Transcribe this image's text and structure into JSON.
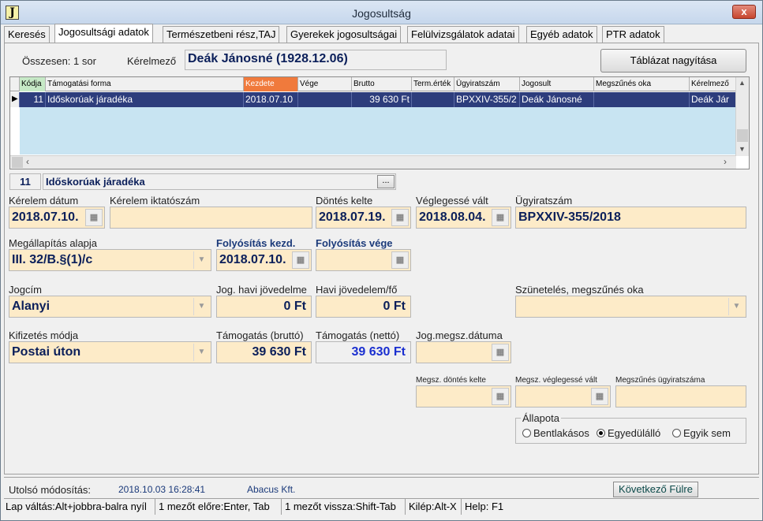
{
  "window": {
    "title": "Jogosultság",
    "app_icon_letter": "J",
    "close_label": "x"
  },
  "tabs": [
    {
      "label": "Keresés"
    },
    {
      "label": "Jogosultsági adatok"
    },
    {
      "label": "Természetbeni rész,TAJ"
    },
    {
      "label": "Gyerekek jogosultságai"
    },
    {
      "label": "Felülvizsgálatok adatai"
    },
    {
      "label": "Egyéb adatok"
    },
    {
      "label": "PTR adatok"
    }
  ],
  "summary": {
    "total_label": "Összesen: 1 sor",
    "applicant_label": "Kérelmező",
    "applicant_value": "Deák Jánosné (1928.12.06)",
    "enlarge_button": "Táblázat nagyítása"
  },
  "grid": {
    "columns": [
      "Kódja",
      "Támogatási forma",
      "Kezdete",
      "Vége",
      "Brutto",
      "Term.érték",
      "Ügyiratszám",
      "Jogosult",
      "Megszűnés oka",
      "Kérelmező"
    ],
    "rows": [
      [
        "11",
        "Időskorúak járadéka",
        "2018.07.10",
        "",
        "39 630 Ft",
        "",
        "BPXXIV-355/2",
        "Deák Jánosné",
        "",
        "Deák Jár"
      ]
    ]
  },
  "support_type": {
    "code": "11",
    "name": "Időskorúak járadéka",
    "browse_label": "..."
  },
  "fields": {
    "kerelem_datum": {
      "label": "Kérelem dátum",
      "value": "2018.07.10."
    },
    "kerelem_iktatoszam": {
      "label": "Kérelem iktatószám",
      "value": ""
    },
    "dontes_kelte": {
      "label": "Döntés kelte",
      "value": "2018.07.19."
    },
    "veglegesse_valt": {
      "label": "Véglegessé vált",
      "value": "2018.08.04."
    },
    "ugyiratszam": {
      "label": "Ügyiratszám",
      "value": "BPXXIV-355/2018"
    },
    "megallapitas_alapja": {
      "label": "Megállapítás alapja",
      "value": "III. 32/B.§(1)/c"
    },
    "folyositas_kezd": {
      "label": "Folyósítás kezd.",
      "value": "2018.07.10."
    },
    "folyositas_vege": {
      "label": "Folyósítás vége",
      "value": ""
    },
    "jogcim": {
      "label": "Jogcím",
      "value": "Alanyi"
    },
    "jog_havi_jovedelme": {
      "label": "Jog. havi jövedelme",
      "value": "0 Ft"
    },
    "havi_jovedelem_fo": {
      "label": "Havi jövedelem/fő",
      "value": "0 Ft"
    },
    "szunetelés_oka": {
      "label": "Szünetelés, megszűnés oka",
      "value": ""
    },
    "kifizetes_modja": {
      "label": "Kifizetés módja",
      "value": "Postai úton"
    },
    "tamogatas_brutto": {
      "label": "Támogatás (bruttó)",
      "value": "39 630 Ft"
    },
    "tamogatas_netto": {
      "label": "Támogatás (nettó)",
      "value": "39 630 Ft"
    },
    "jog_megsz_datuma": {
      "label": "Jog.megsz.dátuma",
      "value": ""
    },
    "megsz_dontes_kelte": {
      "label": "Megsz. döntés kelte",
      "value": ""
    },
    "megsz_veglegesse_valt": {
      "label": "Megsz. véglegessé vált",
      "value": ""
    },
    "megszunes_ugyiratszama": {
      "label": "Megszűnés ügyiratszáma",
      "value": ""
    }
  },
  "allapota": {
    "label": "Állapota",
    "options": [
      "Bentlakásos",
      "Egyedülálló",
      "Egyik sem"
    ],
    "selected": "Egyedülálló"
  },
  "footer": {
    "last_modified_label": "Utolsó módosítás:",
    "last_modified_value": "2018.10.03 16:28:41",
    "modified_by": "Abacus Kft.",
    "next_tab_button": "Következő Fülre"
  },
  "statusbar": [
    "Lap váltás:Alt+jobbra-balra nyíl",
    "1 mezőt előre:Enter, Tab",
    "1 mezőt vissza:Shift-Tab",
    "Kilép:Alt-X",
    "Help: F1"
  ]
}
